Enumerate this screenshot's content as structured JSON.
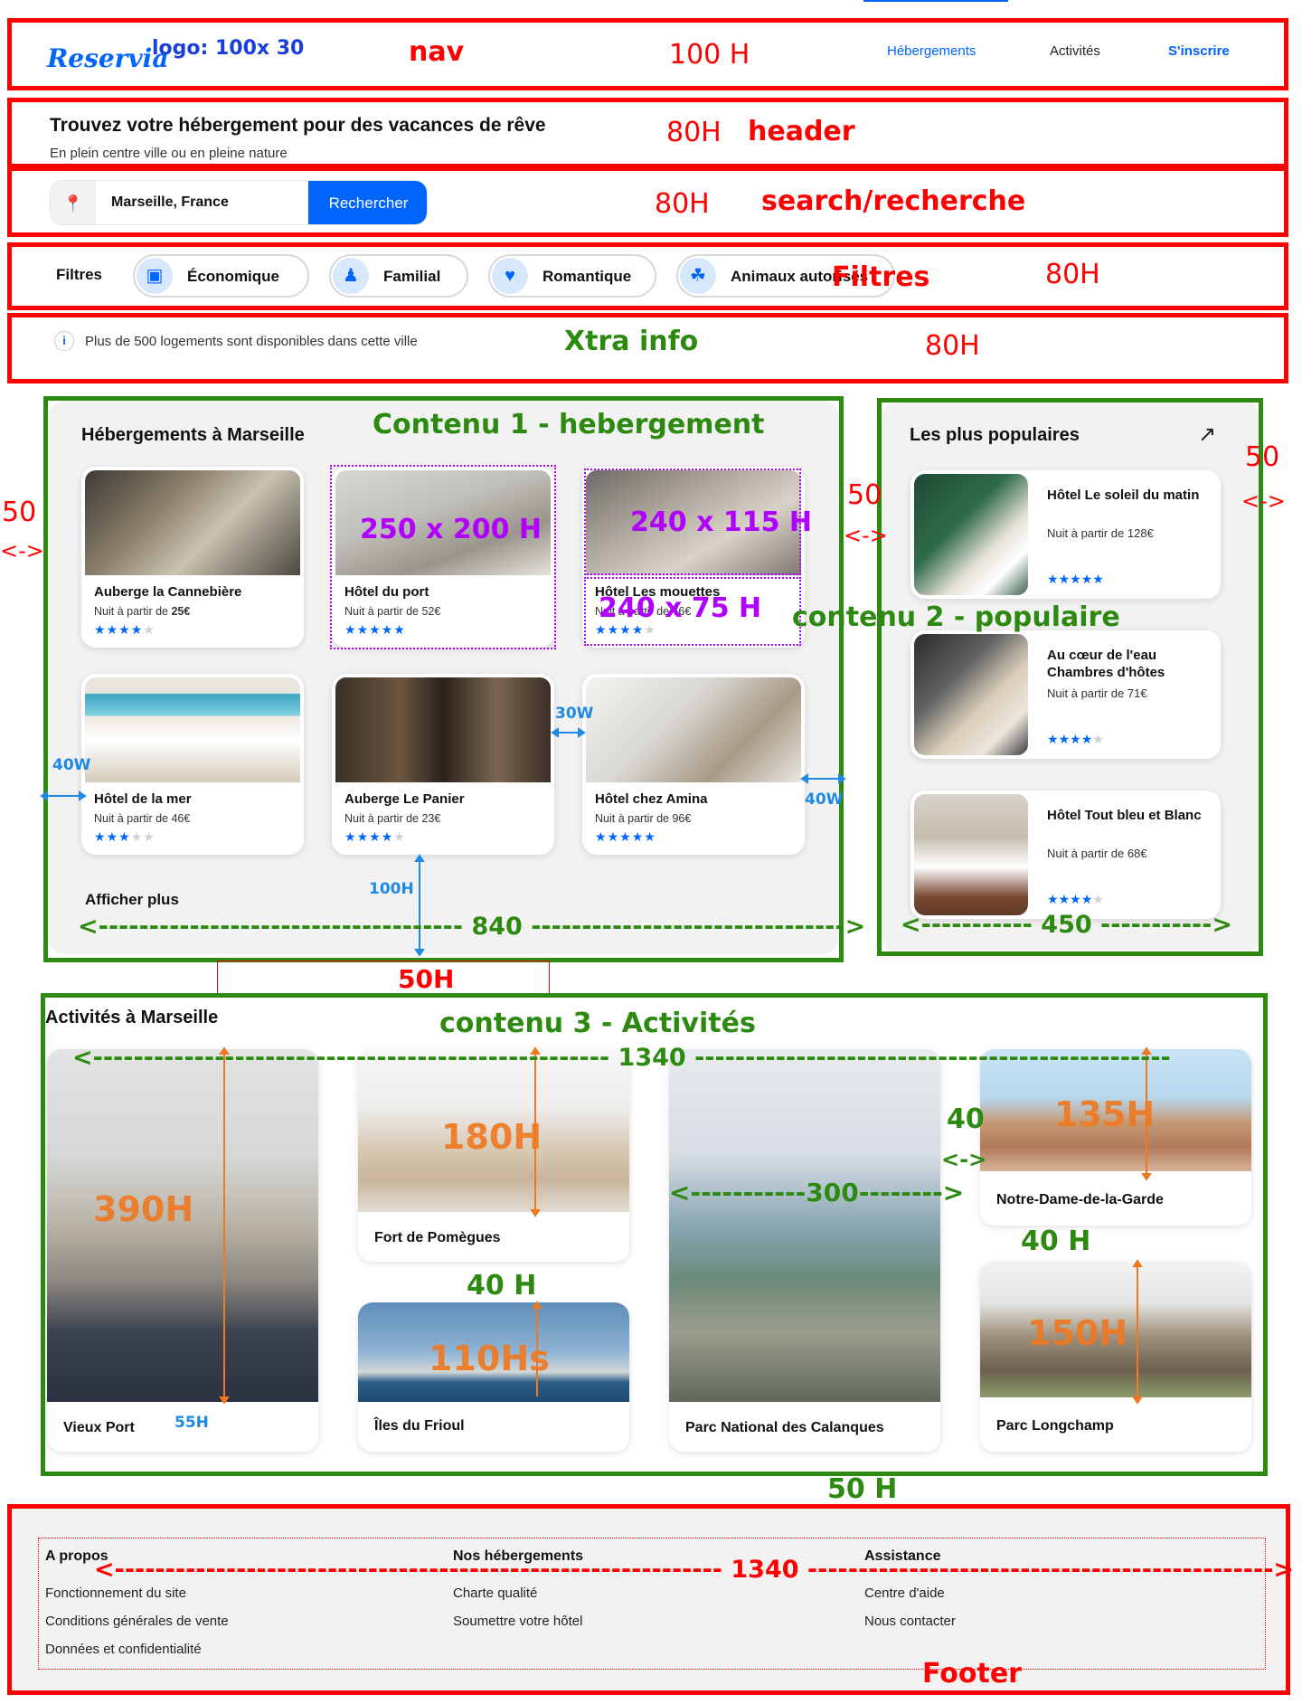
{
  "nav": {
    "logo": "Reservia",
    "links": [
      "Hébergements",
      "Activités",
      "S'inscrire"
    ]
  },
  "header": {
    "title": "Trouvez votre hébergement pour des vacances de rêve",
    "subtitle": "En plein centre ville ou en pleine nature"
  },
  "search": {
    "value": "Marseille, France",
    "button": "Rechercher"
  },
  "filters": {
    "label": "Filtres",
    "items": [
      {
        "label": "Économique",
        "icon": "money-icon"
      },
      {
        "label": "Familial",
        "icon": "child-icon"
      },
      {
        "label": "Romantique",
        "icon": "heart-icon"
      },
      {
        "label": "Animaux autorisés",
        "icon": "dog-icon"
      }
    ]
  },
  "info": {
    "text": "Plus de 500 logements sont disponibles dans cette ville"
  },
  "hebergements": {
    "title": "Hébergements à Marseille",
    "more": "Afficher plus",
    "cards": [
      {
        "name": "Auberge la Cannebière",
        "price_prefix": "Nuit à partir de ",
        "price": "25€",
        "rating": 4
      },
      {
        "name": "Hôtel du port",
        "price_prefix": "Nuit à partir de ",
        "price": "52€",
        "rating": 5
      },
      {
        "name": "Hôtel Les mouettes",
        "price_prefix": "Nuit à partir de ",
        "price": "76€",
        "rating": 4
      },
      {
        "name": "Hôtel de la mer",
        "price_prefix": "Nuit à partir de ",
        "price": "46€",
        "rating": 3
      },
      {
        "name": "Auberge Le Panier",
        "price_prefix": "Nuit à partir de ",
        "price": "23€",
        "rating": 4
      },
      {
        "name": "Hôtel chez Amina",
        "price_prefix": "Nuit à partir de ",
        "price": "96€",
        "rating": 5
      }
    ]
  },
  "populaires": {
    "title": "Les plus populaires",
    "icon": "trending-icon",
    "cards": [
      {
        "name": "Hôtel Le soleil du matin",
        "price": "Nuit à partir de 128€",
        "rating": 5
      },
      {
        "name": "Au cœur de l'eau Chambres d'hôtes",
        "price": "Nuit à partir de 71€",
        "rating": 4
      },
      {
        "name": "Hôtel Tout bleu et Blanc",
        "price": "Nuit à partir de 68€",
        "rating": 4
      }
    ]
  },
  "activites": {
    "title": "Activités à Marseille",
    "cards": [
      "Vieux Port",
      "Fort de Pomègues",
      "Îles du Frioul",
      "Parc National des Calanques",
      "Notre-Dame-de-la-Garde",
      "Parc Longchamp"
    ]
  },
  "footer": {
    "columns": [
      {
        "title": "A propos",
        "links": [
          "Fonctionnement du site",
          "Conditions générales de vente",
          "Données et confidentialité"
        ]
      },
      {
        "title": "Nos hébergements",
        "links": [
          "Charte qualité",
          "Soumettre votre hôtel"
        ]
      },
      {
        "title": "Assistance",
        "links": [
          "Centre d'aide",
          "Nous contacter"
        ]
      }
    ]
  },
  "annotations": {
    "logo_size": "logo: 100x 30",
    "nav": "nav",
    "nav_h": "100 H",
    "header": "header",
    "header_h": "80H",
    "search": "search/recherche",
    "search_h": "80H",
    "filtres": "Filtres",
    "filtres_h": "80H",
    "xtra": "Xtra info",
    "xtra_h": "80H",
    "contenu1": "Contenu 1 - hebergement",
    "contenu2": "contenu 2 - populaire",
    "contenu3": "contenu 3 - Activités",
    "footer": "Footer",
    "card_size": "250 x 200 H",
    "img_size": "240 x 115 H",
    "text_size": "240 x 75 H",
    "gap_50a": "50",
    "gap_50b": "50",
    "gap_50c": "50",
    "arrows": "<->",
    "w40a": "40W",
    "w40b": "40W",
    "w30": "30W",
    "h100": "100H",
    "w840": "<------------------------------------ 840 ------------------------------->",
    "w450": "<----------- 450 ----------->",
    "h50_red": "50H",
    "w1340": "<--------------------------------------------------- 1340 -----------------------------------------------",
    "h390": "390H",
    "h55": "55H",
    "h180": "180H",
    "h40a": "40 H",
    "h110": "110Hs",
    "w300": "<-----------300-------->",
    "g40": "40",
    "h135": "135H",
    "h40b": "40 H",
    "h150": "150H",
    "h50_green": "50 H",
    "w1340_footer": "<------------------------------------------------------------ 1340 ---------------------------------------------->"
  }
}
